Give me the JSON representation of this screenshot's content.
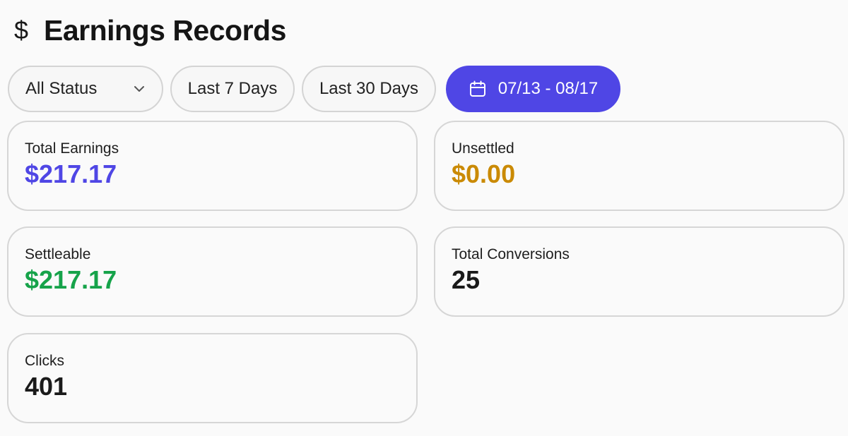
{
  "header": {
    "icon": "dollar-icon",
    "title": "Earnings Records"
  },
  "filters": {
    "status_label": "All Status",
    "status_icon": "chevron-down-icon",
    "last7_label": "Last 7 Days",
    "last30_label": "Last 30 Days",
    "range_icon": "calendar-icon",
    "range_label": "07/13 - 08/17"
  },
  "stats": {
    "total_earnings": {
      "label": "Total Earnings",
      "value": "$217.17",
      "color": "#4f46e5"
    },
    "unsettled": {
      "label": "Unsettled",
      "value": "$0.00",
      "color": "#ca8a04"
    },
    "settleable": {
      "label": "Settleable",
      "value": "$217.17",
      "color": "#16a34a"
    },
    "total_conversions": {
      "label": "Total Conversions",
      "value": "25",
      "color": "#1a1a1a"
    },
    "clicks": {
      "label": "Clicks",
      "value": "401",
      "color": "#1a1a1a"
    }
  },
  "colors": {
    "accent": "#4f46e5",
    "background": "#fafafa",
    "border": "#d6d6d6"
  }
}
